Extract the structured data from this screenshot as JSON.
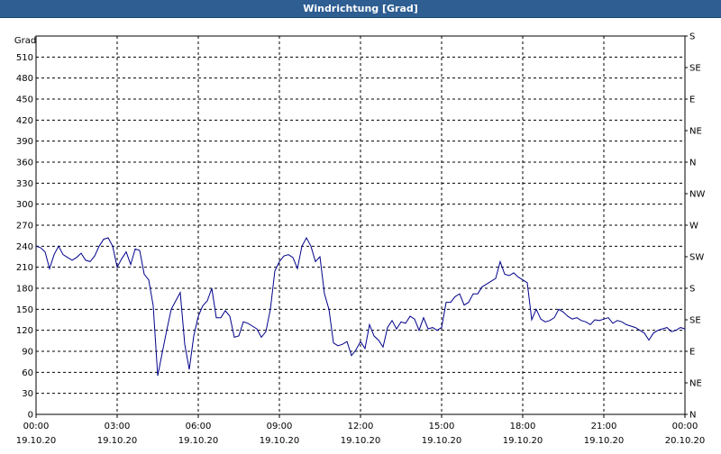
{
  "window": {
    "title": "Windrichtung [Grad]"
  },
  "chart_data": {
    "type": "line",
    "title": "Windrichtung [Grad]",
    "ylabel": "Grad",
    "ylim": [
      0,
      540
    ],
    "yticks": [
      0,
      30,
      60,
      90,
      120,
      150,
      180,
      210,
      240,
      270,
      300,
      330,
      360,
      390,
      420,
      450,
      480,
      510
    ],
    "right_axis_labels": [
      {
        "value": 0,
        "label": "N"
      },
      {
        "value": 45,
        "label": "NE"
      },
      {
        "value": 90,
        "label": "E"
      },
      {
        "value": 135,
        "label": "SE"
      },
      {
        "value": 180,
        "label": "S"
      },
      {
        "value": 225,
        "label": "SW"
      },
      {
        "value": 270,
        "label": "W"
      },
      {
        "value": 315,
        "label": "NW"
      },
      {
        "value": 360,
        "label": "N"
      },
      {
        "value": 405,
        "label": "NE"
      },
      {
        "value": 450,
        "label": "E"
      },
      {
        "value": 495,
        "label": "SE"
      },
      {
        "value": 540,
        "label": "S"
      }
    ],
    "xlim": [
      0,
      24
    ],
    "x_ticks": [
      {
        "time": 0,
        "label": "00:00",
        "date": "19.10.20"
      },
      {
        "time": 3,
        "label": "03:00",
        "date": "19.10.20"
      },
      {
        "time": 6,
        "label": "06:00",
        "date": "19.10.20"
      },
      {
        "time": 9,
        "label": "09:00",
        "date": "19.10.20"
      },
      {
        "time": 12,
        "label": "12:00",
        "date": "19.10.20"
      },
      {
        "time": 15,
        "label": "15:00",
        "date": "19.10.20"
      },
      {
        "time": 18,
        "label": "18:00",
        "date": "19.10.20"
      },
      {
        "time": 21,
        "label": "21:00",
        "date": "19.10.20"
      },
      {
        "time": 24,
        "label": "00:00",
        "date": "20.10.20"
      }
    ],
    "grid": true,
    "line_color": "#00008b",
    "series": [
      {
        "x": [
          0,
          0.167,
          0.333,
          0.5,
          0.667,
          0.833,
          1.0,
          1.167,
          1.333,
          1.5,
          1.667,
          1.833,
          2.0,
          2.167,
          2.333,
          2.5,
          2.667,
          2.833,
          3.0,
          3.167,
          3.333,
          3.5,
          3.667,
          3.833,
          4.0,
          4.167,
          4.333,
          4.5,
          4.667,
          4.833,
          5.0,
          5.167,
          5.333,
          5.5,
          5.667,
          5.833,
          6.0,
          6.167,
          6.333,
          6.5,
          6.667,
          6.833,
          7.0,
          7.167,
          7.333,
          7.5,
          7.667,
          7.833,
          8.0,
          8.167,
          8.333,
          8.5,
          8.667,
          8.833,
          9.0,
          9.167,
          9.333,
          9.5,
          9.667,
          9.833,
          10.0,
          10.167,
          10.333,
          10.5,
          10.667,
          10.833,
          11.0,
          11.167,
          11.333,
          11.5,
          11.667,
          11.833,
          12.0,
          12.167,
          12.333,
          12.5,
          12.667,
          12.833,
          13.0,
          13.167,
          13.333,
          13.5,
          13.667,
          13.833,
          14.0,
          14.167,
          14.333,
          14.5,
          14.667,
          14.833,
          15.0,
          15.167,
          15.333,
          15.5,
          15.667,
          15.833,
          16.0,
          16.167,
          16.333,
          16.5,
          16.667,
          16.833,
          17.0,
          17.167,
          17.333,
          17.5,
          17.667,
          17.833,
          18.0,
          18.167,
          18.333,
          18.5,
          18.667,
          18.833,
          19.0,
          19.167,
          19.333,
          19.5,
          19.667,
          19.833,
          20.0,
          20.167,
          20.333,
          20.5,
          20.667,
          20.833,
          21.0,
          21.167,
          21.333,
          21.5,
          21.667,
          21.833,
          22.0,
          22.167,
          22.333,
          22.5,
          22.667,
          22.833,
          23.0,
          23.167,
          23.333,
          23.5,
          23.667,
          23.833,
          24.0
        ],
        "values": [
          240,
          238,
          232,
          208,
          228,
          240,
          228,
          224,
          220,
          224,
          230,
          220,
          218,
          226,
          240,
          250,
          252,
          240,
          210,
          222,
          232,
          214,
          236,
          234,
          200,
          192,
          155,
          55,
          88,
          120,
          150,
          162,
          174,
          100,
          64,
          112,
          140,
          155,
          162,
          180,
          138,
          138,
          148,
          140,
          110,
          112,
          132,
          130,
          126,
          122,
          110,
          118,
          150,
          205,
          218,
          226,
          228,
          224,
          208,
          240,
          252,
          240,
          218,
          225,
          172,
          150,
          102,
          98,
          100,
          104,
          84,
          92,
          104,
          94,
          128,
          112,
          106,
          96,
          124,
          134,
          122,
          132,
          130,
          140,
          136,
          120,
          138,
          122,
          124,
          120,
          124,
          160,
          160,
          168,
          172,
          156,
          160,
          172,
          172,
          182,
          186,
          190,
          194,
          218,
          200,
          198,
          202,
          196,
          192,
          188,
          135,
          150,
          136,
          132,
          134,
          138,
          150,
          146,
          140,
          136,
          138,
          134,
          132,
          128,
          135,
          134,
          136,
          138,
          130,
          134,
          132,
          128,
          126,
          124,
          120,
          116,
          106,
          116,
          120,
          122,
          124,
          118,
          120,
          124,
          122
        ]
      }
    ]
  }
}
